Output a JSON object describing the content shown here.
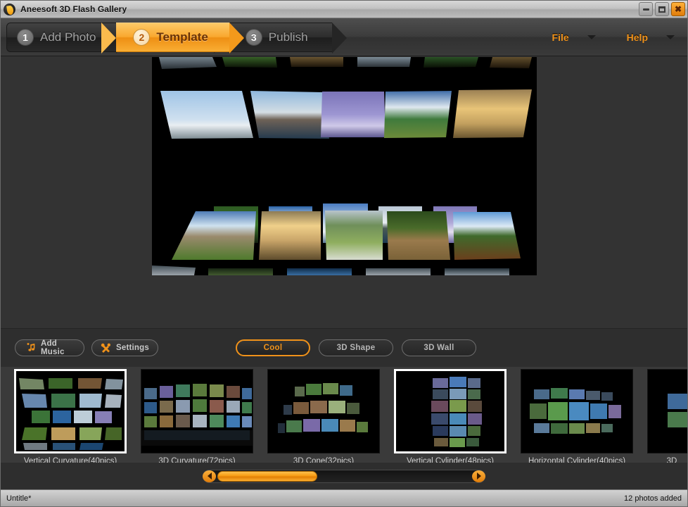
{
  "window": {
    "title": "Aneesoft 3D Flash Gallery",
    "logo_icon": "app-logo-icon",
    "controls": {
      "minimize": "minimize-icon",
      "maximize": "maximize-icon",
      "close": "close-icon",
      "close_glyph": "✖"
    }
  },
  "steps": [
    {
      "number": "1",
      "label": "Add Photo",
      "active": false
    },
    {
      "number": "2",
      "label": "Template",
      "active": true
    },
    {
      "number": "3",
      "label": "Publish",
      "active": false
    }
  ],
  "menus": [
    {
      "label": "File",
      "icon": "chevron-down-icon"
    },
    {
      "label": "Help",
      "icon": "chevron-down-icon"
    }
  ],
  "toolbar": {
    "add_music_label": "Add Music",
    "add_music_icon": "music-note-plus-icon",
    "settings_label": "Settings",
    "settings_icon": "tools-icon"
  },
  "category_tabs": [
    {
      "label": "Cool",
      "active": true
    },
    {
      "label": "3D Shape",
      "active": false
    },
    {
      "label": "3D Wall",
      "active": false
    }
  ],
  "templates": [
    {
      "label": "Vertical Curvature(40pics)",
      "selected": true,
      "partial": false
    },
    {
      "label": "3D Curvature(72pics)",
      "selected": false,
      "partial": false
    },
    {
      "label": "3D Cone(32pics)",
      "selected": false,
      "partial": false
    },
    {
      "label": "Vertical Cylinder(48pics)",
      "selected": true,
      "partial": false
    },
    {
      "label": "Horizontal Cylinder(40pics)",
      "selected": false,
      "partial": false
    },
    {
      "label": "3D",
      "selected": false,
      "partial": true
    }
  ],
  "scrollbar": {
    "left_arrow_icon": "arrow-left-icon",
    "right_arrow_icon": "arrow-right-icon",
    "thumb_position_percent": 0,
    "thumb_width_percent": 38
  },
  "statusbar": {
    "project_name": "Untitle*",
    "photo_count_text": "12 photos added"
  },
  "colors": {
    "accent": "#f0921a",
    "active_step_bg": "#f9a82f",
    "panel_bg": "#2e2e2e",
    "template_panel_bg": "#3a3a3a",
    "preview_bg": "#333333",
    "stage_bg": "#000000"
  }
}
